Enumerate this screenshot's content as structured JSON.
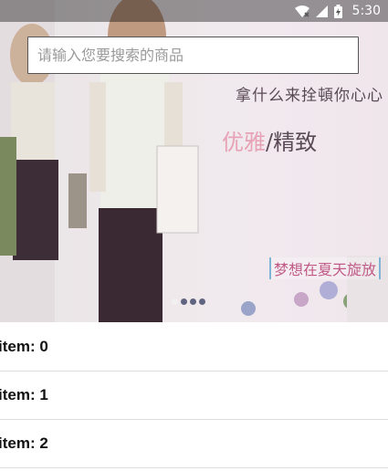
{
  "status_bar": {
    "time": "5:30",
    "icons": [
      "wifi-icon",
      "signal-icon",
      "battery-icon"
    ]
  },
  "search": {
    "placeholder": "请输入您要搜索的商品"
  },
  "banner": {
    "line_1": "拿什么来拴頓你心心",
    "line_2_part_1": "优雅",
    "line_2_part_2": "/精致",
    "line_3": "梦想在夏天旋放",
    "page_indicator": {
      "count": 4,
      "active": 0
    }
  },
  "list": {
    "items": [
      {
        "label": "item:  0"
      },
      {
        "label": "item:  1"
      },
      {
        "label": "item:  2"
      }
    ]
  }
}
